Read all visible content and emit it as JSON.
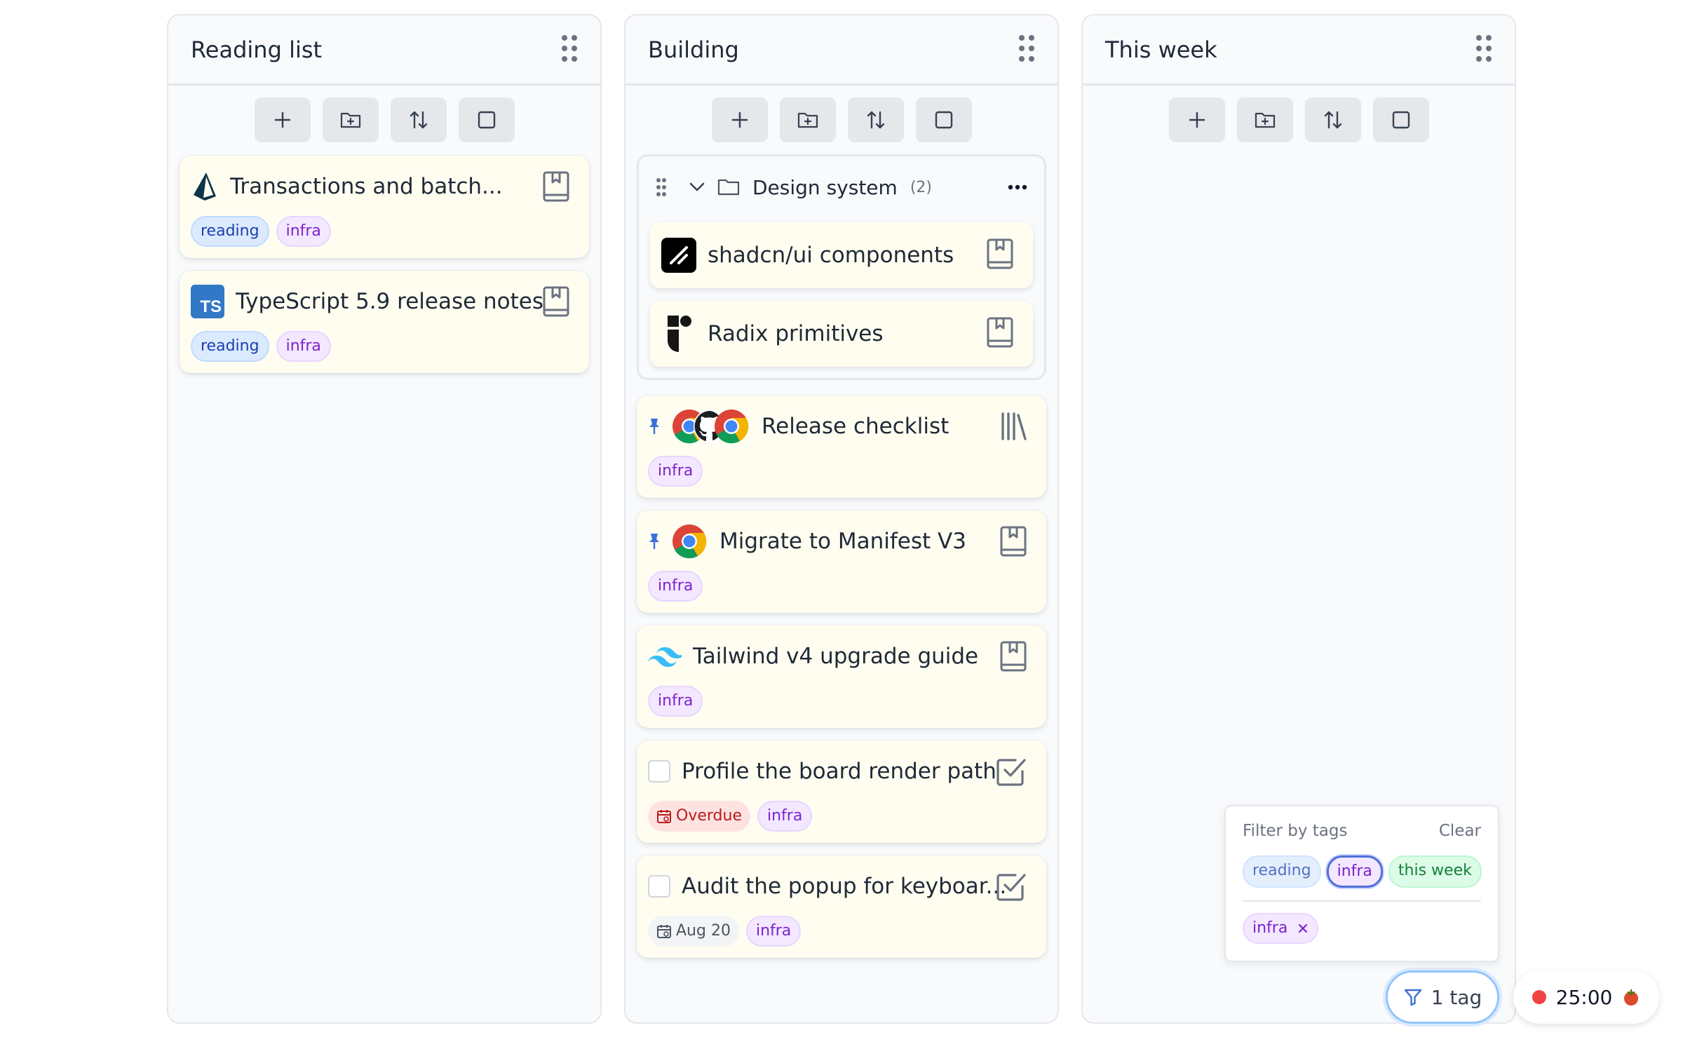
{
  "columns": [
    {
      "title": "Reading list",
      "cards": [
        {
          "title": "Transactions and batch...",
          "tags": [
            "reading",
            "infra"
          ]
        },
        {
          "title": "TypeScript 5.9 release notes",
          "favicon_text": "TS",
          "tags": [
            "reading",
            "infra"
          ]
        }
      ]
    },
    {
      "title": "Building",
      "group": {
        "title": "Design system",
        "count": "(2)",
        "items": [
          {
            "title": "shadcn/ui components"
          },
          {
            "title": "Radix primitives"
          }
        ]
      },
      "cards": [
        {
          "title": "Release checklist",
          "tags": [
            "infra"
          ]
        },
        {
          "title": "Migrate to Manifest V3",
          "tags": [
            "infra"
          ]
        },
        {
          "title": "Tailwind v4 upgrade guide",
          "tags": [
            "infra"
          ]
        },
        {
          "title": "Profile the board render path",
          "due": "Overdue",
          "tags": [
            "infra"
          ]
        },
        {
          "title": "Audit the popup for keyboar...",
          "due": "Aug 20",
          "tags": [
            "infra"
          ]
        }
      ]
    },
    {
      "title": "This week",
      "cards": []
    }
  ],
  "filter": {
    "heading": "Filter by tags",
    "clear_label": "Clear",
    "options": [
      "reading",
      "infra",
      "this week"
    ],
    "selected": "infra"
  },
  "filter_button": {
    "label": "1 tag"
  },
  "timer": {
    "value": "25:00"
  },
  "colors": {
    "accent": "#3b82f6",
    "reading": "#1e40af",
    "infra": "#7e22ce",
    "week": "#15803d",
    "overdue": "#b91c1c"
  }
}
